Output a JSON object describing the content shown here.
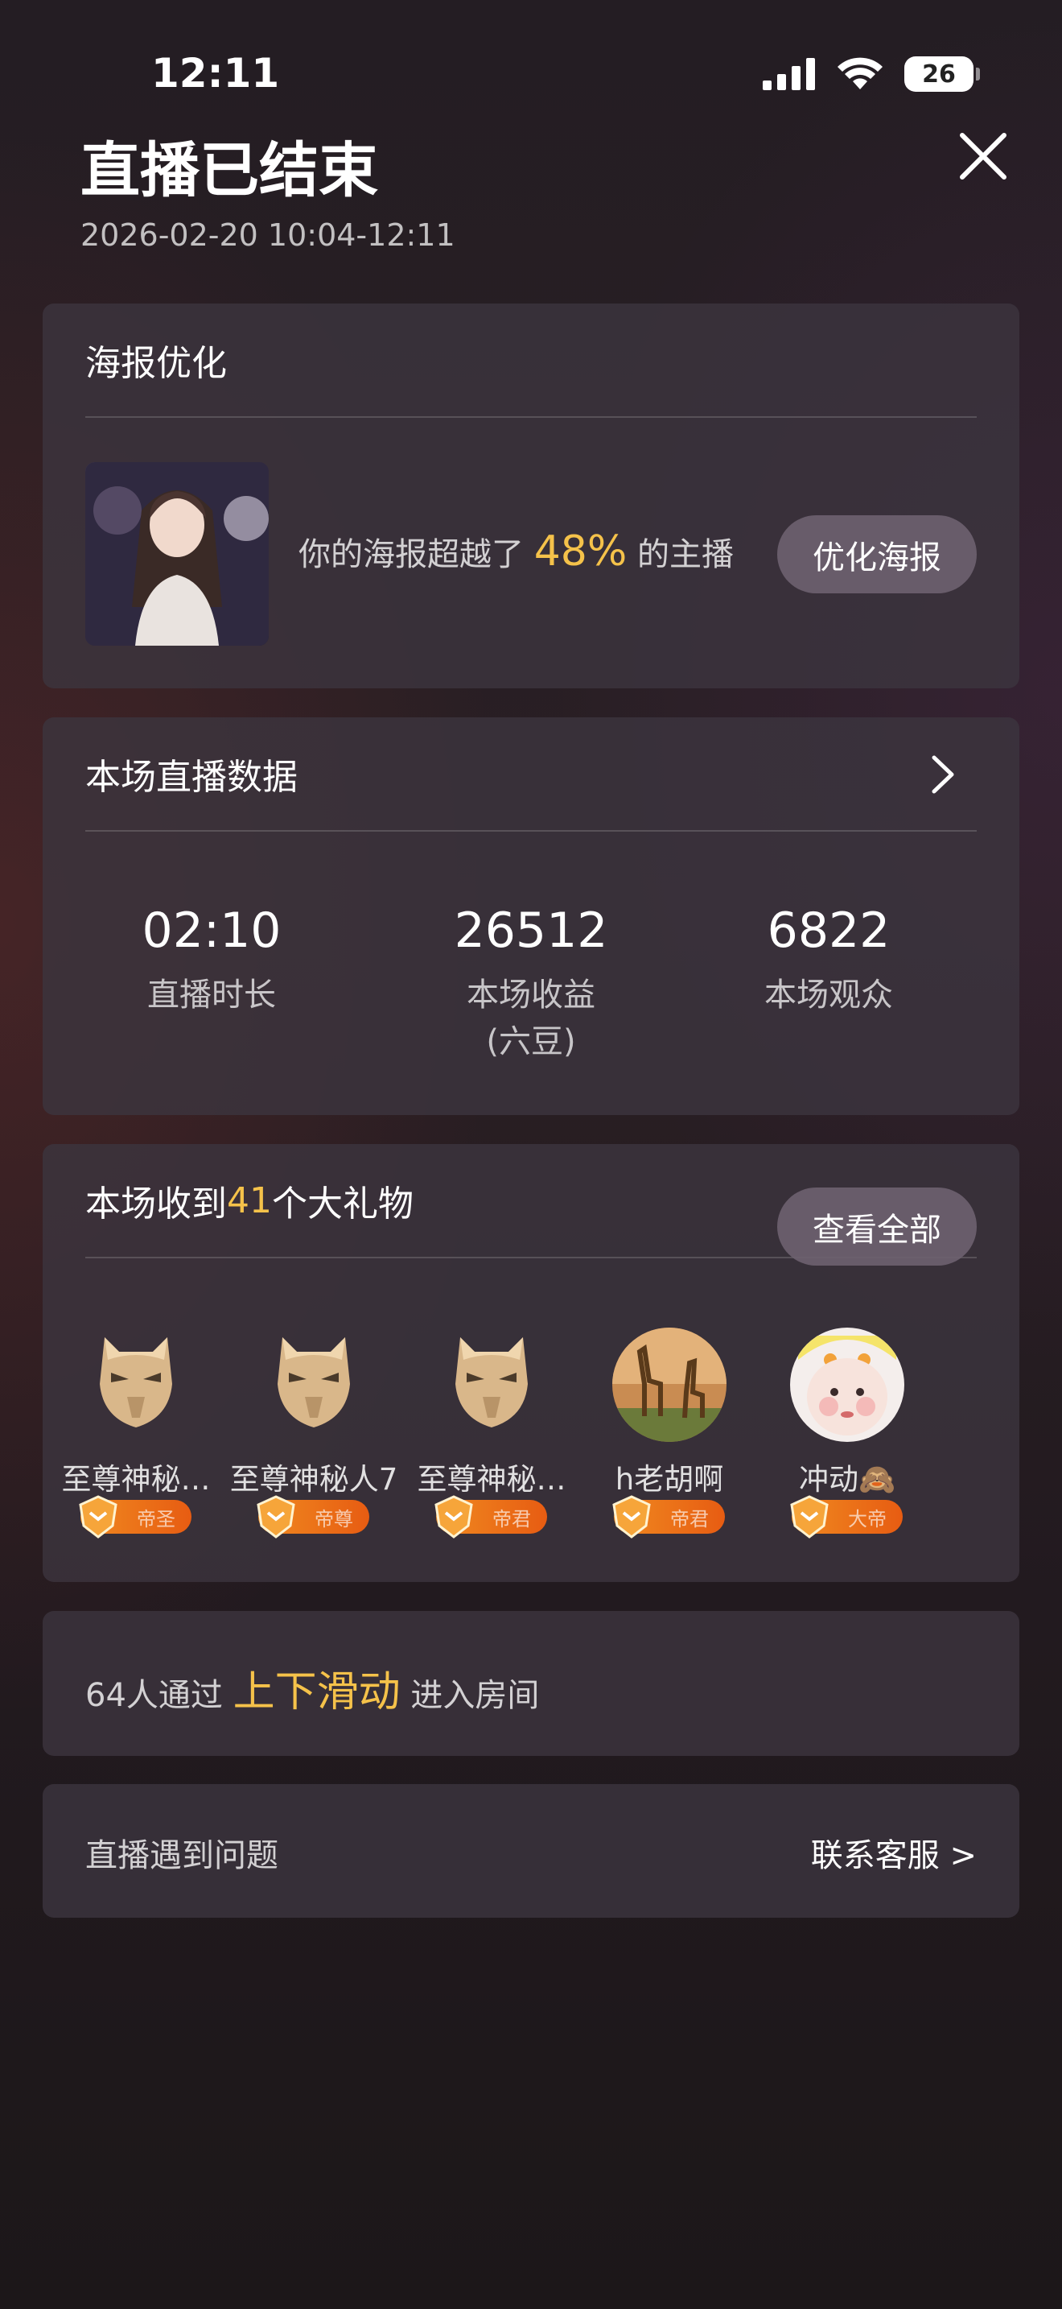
{
  "status_bar": {
    "time": "12:11",
    "battery": "26"
  },
  "header": {
    "title": "直播已结束",
    "time_range": "2026-02-20 10:04-12:11"
  },
  "poster": {
    "title": "海报优化",
    "text_before": "你的海报超越了 ",
    "percent": "48%",
    "text_after": " 的主播",
    "button": "优化海报"
  },
  "stats": {
    "title": "本场直播数据",
    "items": [
      {
        "value": "02:10",
        "label": "直播时长"
      },
      {
        "value": "26512",
        "label": "本场收益\n(六豆)"
      },
      {
        "value": "6822",
        "label": "本场观众"
      }
    ]
  },
  "gifts": {
    "title_before": "本场收到 ",
    "count": "41",
    "title_after": " 个大礼物",
    "button": "查看全部",
    "gifters": [
      {
        "name": "至尊神秘…",
        "avatar": "mask-icon",
        "badge": "帝圣"
      },
      {
        "name": "至尊神秘人7",
        "avatar": "mask-icon",
        "badge": "帝尊"
      },
      {
        "name": "至尊神秘…",
        "avatar": "mask-icon",
        "badge": "帝君"
      },
      {
        "name": "h老胡啊",
        "avatar": "giraffe-photo",
        "badge": "帝君"
      },
      {
        "name": "冲动🙈",
        "avatar": "baby-photo",
        "badge": "大帝"
      }
    ]
  },
  "swipe": {
    "text_before": "64人通过 ",
    "highlight": "上下滑动",
    "text_after": " 进入房间"
  },
  "problem": {
    "label": "直播遇到问题",
    "link": "联系客服 >"
  },
  "colors": {
    "accent": "#f5c24a",
    "card_bg": "#3c343e",
    "badge": "#ee7a1a"
  }
}
